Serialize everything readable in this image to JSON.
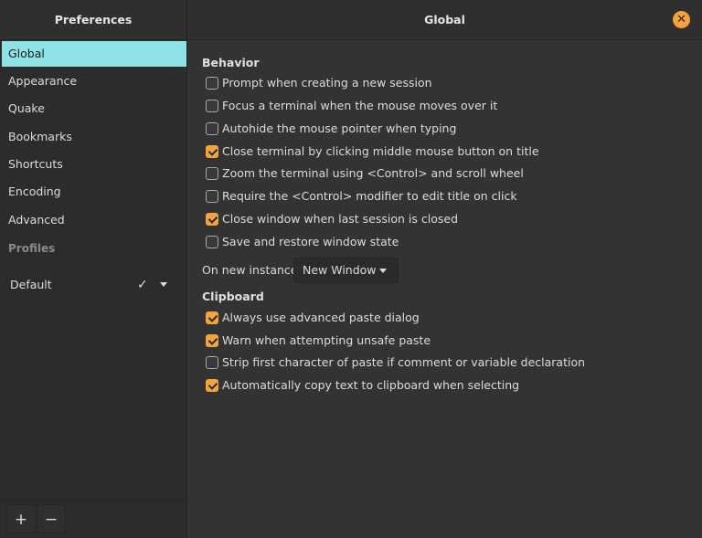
{
  "sidebar": {
    "title": "Preferences",
    "items": [
      {
        "label": "Global",
        "active": true
      },
      {
        "label": "Appearance",
        "active": false
      },
      {
        "label": "Quake",
        "active": false
      },
      {
        "label": "Bookmarks",
        "active": false
      },
      {
        "label": "Shortcuts",
        "active": false
      },
      {
        "label": "Encoding",
        "active": false
      },
      {
        "label": "Advanced",
        "active": false
      }
    ],
    "profiles_label": "Profiles",
    "profile": {
      "name": "Default",
      "check": "✓"
    },
    "add_label": "+",
    "remove_label": "−"
  },
  "main": {
    "title": "Global",
    "close_icon": "✕",
    "behavior": {
      "title": "Behavior",
      "options": [
        {
          "label": "Prompt when creating a new session",
          "checked": false
        },
        {
          "label": "Focus a terminal when the mouse moves over it",
          "checked": false
        },
        {
          "label": "Autohide the mouse pointer when typing",
          "checked": false
        },
        {
          "label": "Close terminal by clicking middle mouse button on title",
          "checked": true
        },
        {
          "label": "Zoom the terminal using <Control> and scroll wheel",
          "checked": false
        },
        {
          "label": "Require the <Control> modifier to edit title on click",
          "checked": false
        },
        {
          "label": "Close window when last session is closed",
          "checked": true
        },
        {
          "label": "Save and restore window state",
          "checked": false
        }
      ]
    },
    "new_instance": {
      "label": "On new instance",
      "value": "New Window"
    },
    "clipboard": {
      "title": "Clipboard",
      "options": [
        {
          "label": "Always use advanced paste dialog",
          "checked": true
        },
        {
          "label": "Warn when attempting unsafe paste",
          "checked": true
        },
        {
          "label": "Strip first character of paste if comment or variable declaration",
          "checked": false
        },
        {
          "label": "Automatically copy text to clipboard when selecting",
          "checked": true
        }
      ]
    }
  },
  "colors": {
    "accent": "#f5a33d",
    "selection": "#8ee3e6"
  }
}
